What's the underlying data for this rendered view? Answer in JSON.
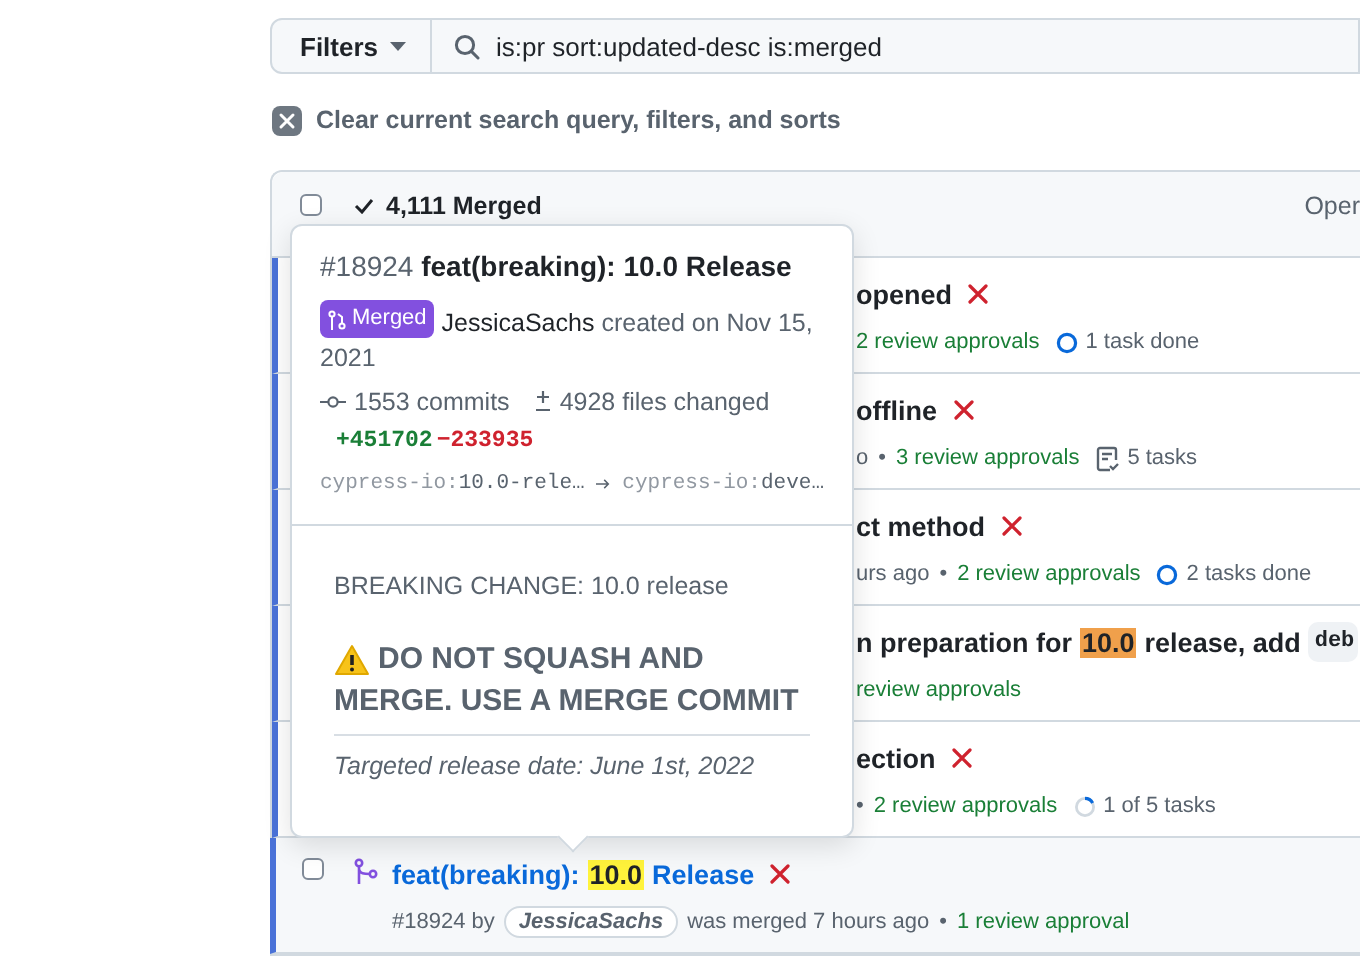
{
  "filters_button": {
    "label": "Filters"
  },
  "search": {
    "value": "is:pr sort:updated-desc is:merged"
  },
  "clear_filters": {
    "label": "Clear current search query, filters, and sorts"
  },
  "list_header": {
    "checked": false,
    "count": "4,111 Merged",
    "right_label": "Oper"
  },
  "rows": [
    {
      "kind": "partial",
      "ci_failed": true,
      "title": [
        {
          "text": "opened",
          "kind": "plain"
        }
      ],
      "meta": [
        {
          "text": "2 review approvals",
          "kind": "approval"
        },
        {
          "text": "1 task done",
          "kind": "tasks-done"
        }
      ]
    },
    {
      "kind": "partial",
      "ci_failed": true,
      "title": [
        {
          "text": "offline",
          "kind": "plain"
        }
      ],
      "meta": [
        {
          "text": "o",
          "kind": "plain"
        },
        {
          "text": "•",
          "kind": "sep"
        },
        {
          "text": "3 review approvals",
          "kind": "approval"
        },
        {
          "text": "5 tasks",
          "kind": "tasks-list"
        }
      ]
    },
    {
      "kind": "partial",
      "ci_failed": true,
      "title": [
        {
          "text": "ct method",
          "kind": "plain"
        }
      ],
      "meta": [
        {
          "text": "urs ago",
          "kind": "plain"
        },
        {
          "text": "•",
          "kind": "sep"
        },
        {
          "text": "2 review approvals",
          "kind": "approval"
        },
        {
          "text": "2 tasks done",
          "kind": "tasks-done"
        }
      ]
    },
    {
      "kind": "partial",
      "title": [
        {
          "text": "n preparation for",
          "kind": "plain"
        },
        {
          "text": "10.0",
          "kind": "match-orange"
        },
        {
          "text": "release, add",
          "kind": "plain"
        },
        {
          "text": "deb",
          "kind": "code"
        }
      ],
      "meta": [
        {
          "text": "review approvals",
          "kind": "approval"
        }
      ]
    },
    {
      "kind": "partial",
      "ci_failed": true,
      "title": [
        {
          "text": "ection",
          "kind": "plain"
        }
      ],
      "meta": [
        {
          "text": "•",
          "kind": "sep"
        },
        {
          "text": "2 review approvals",
          "kind": "approval"
        },
        {
          "text": "1 of 5 tasks",
          "kind": "tasks-progress"
        }
      ]
    },
    {
      "kind": "full",
      "checked": false,
      "ci_failed": true,
      "title": [
        {
          "text": "feat(breaking):",
          "kind": "plain"
        },
        {
          "text": "10.0",
          "kind": "match-yellow"
        },
        {
          "text": "Release",
          "kind": "plain"
        }
      ],
      "meta": [
        {
          "text": "#18924 by",
          "kind": "plain"
        },
        {
          "text": "JessicaSachs",
          "kind": "author"
        },
        {
          "text": "was merged 7 hours ago",
          "kind": "plain"
        },
        {
          "text": "•",
          "kind": "sep"
        },
        {
          "text": "1 review approval",
          "kind": "approval"
        }
      ]
    }
  ],
  "hover_card": {
    "number": "#18924",
    "title": "feat(breaking): 10.0 Release",
    "state_badge": "Merged",
    "author": "JessicaSachs",
    "created_lines": [
      "created on Nov 15,",
      "2021"
    ],
    "commits": "1553 commits",
    "files": "4928 files changed",
    "additions": "+451702",
    "deletions": "−233935",
    "head_branch": {
      "owner": "cypress-io:",
      "name": "10.0-rele…"
    },
    "base_branch": {
      "owner": "cypress-io:",
      "name": "deve…"
    },
    "body_heading": "BREAKING CHANGE: 10.0 release",
    "warning_lines": [
      "DO NOT SQUASH AND",
      "MERGE. USE A MERGE COMMIT"
    ],
    "note": "Targeted release date: June 1st, 2022"
  }
}
